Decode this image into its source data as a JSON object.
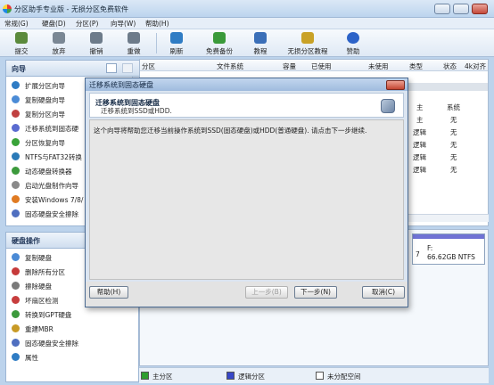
{
  "app": {
    "title": "分区助手专业版 - 无损分区免费软件"
  },
  "menu": [
    "常规(G)",
    "硬盘(D)",
    "分区(P)",
    "向导(W)",
    "帮助(H)"
  ],
  "toolbar": [
    {
      "label": "提交",
      "icon": "check-icon"
    },
    {
      "label": "放弃",
      "icon": "discard-icon"
    },
    {
      "label": "撤销",
      "icon": "undo-icon"
    },
    {
      "label": "重做",
      "icon": "redo-icon"
    },
    {
      "label": "刷新",
      "icon": "refresh-icon"
    },
    {
      "label": "免费备份",
      "icon": "backup-icon"
    },
    {
      "label": "教程",
      "icon": "tutorial-icon"
    },
    {
      "label": "无损分区教程",
      "icon": "partition-tutorial-icon"
    },
    {
      "label": "赞助",
      "icon": "heart-icon"
    }
  ],
  "sidebar": {
    "wizard_title": "向导",
    "wizard_items": [
      "扩展分区向导",
      "复制硬盘向导",
      "复制分区向导",
      "迁移系统到固态硬",
      "分区恢复向导",
      "NTFS与FAT32转换",
      "动态硬盘转换器",
      "启动光盘制作向导",
      "安装Windows 7/8/",
      "固态硬盘安全擦除"
    ],
    "ops_title": "硬盘操作",
    "ops_items": [
      "复制硬盘",
      "删除所有分区",
      "擦除硬盘",
      "坏扇区检测",
      "转换到GPT硬盘",
      "重建MBR",
      "固态硬盘安全擦除",
      "属性"
    ]
  },
  "table": {
    "columns": [
      "分区",
      "文件系统",
      "容量",
      "已使用",
      "未使用",
      "类型",
      "状态",
      "4k对齐"
    ],
    "rows": [
      {
        "type": "主",
        "status": "系统"
      },
      {
        "type": "主",
        "status": "无"
      },
      {
        "type": "逻辑",
        "status": "无"
      },
      {
        "type": "逻辑",
        "status": "无"
      },
      {
        "type": "逻辑",
        "status": "无"
      },
      {
        "type": "逻辑",
        "status": "无"
      }
    ]
  },
  "disk": {
    "drive": "F:",
    "size": "66.62GB NTFS",
    "index": "7"
  },
  "legend": [
    "主分区",
    "逻辑分区",
    "未分配空间"
  ],
  "dialog": {
    "title": "迁移系统到固态硬盘",
    "heading": "迁移系统到固态硬盘",
    "subheading": "迁移系统到SSD或HDD.",
    "body": "这个向导将帮助您迁移当前操作系统到SSD(固态硬盘)或HDD(普通硬盘). 请点击下一步继续.",
    "help": "帮助(H)",
    "back": "上一步(B)",
    "next": "下一步(N)",
    "cancel": "取消(C)"
  },
  "colors": {
    "primary": "#2f9e2f",
    "logical": "#3747c8",
    "unallocated": "#ffffff",
    "accent": "#6f72d4"
  }
}
